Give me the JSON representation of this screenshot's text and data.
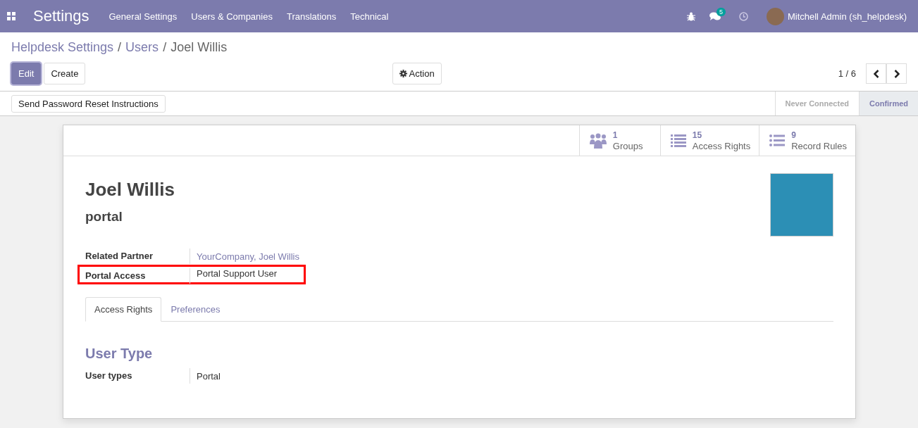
{
  "navbar": {
    "app_title": "Settings",
    "menu": [
      "General Settings",
      "Users & Companies",
      "Translations",
      "Technical"
    ],
    "messages_badge": "5",
    "user": "Mitchell Admin (sh_helpdesk)"
  },
  "breadcrumbs": [
    {
      "label": "Helpdesk Settings",
      "kind": "link"
    },
    {
      "label": "Users",
      "kind": "link",
      "separator": "/"
    },
    {
      "label": "Joel Willis",
      "kind": "current",
      "separator": "/"
    }
  ],
  "buttons": [
    {
      "label": "Edit",
      "kind": "primary"
    },
    {
      "label": "Create",
      "kind": "default"
    }
  ],
  "action_button": "Action",
  "pager": "1 / 6",
  "header_button": "Send Password Reset Instructions",
  "statusbar": [
    {
      "label": "Never Connected",
      "selected": false
    },
    {
      "label": "Confirmed",
      "selected": true
    }
  ],
  "smart_buttons": [
    {
      "count": "1",
      "label": "Groups",
      "kind": "groups"
    },
    {
      "count": "15",
      "label": "Access Rights",
      "kind": "list"
    },
    {
      "count": "9",
      "label": "Record Rules",
      "kind": "rules"
    }
  ],
  "name": "Joel Willis",
  "login": "portal",
  "fields": [
    {
      "label": "Related Partner",
      "value": "YourCompany, Joel Willis",
      "kind": "link",
      "highlighted": false
    },
    {
      "label": "Portal Access",
      "value": "Portal Support User",
      "kind": "text",
      "highlighted": true
    }
  ],
  "tabs": [
    {
      "label": "Access Rights",
      "selected": true
    },
    {
      "label": "Preferences",
      "selected": false
    }
  ],
  "section_title": "User Type",
  "section_fields": [
    {
      "label": "User types",
      "value": "Portal"
    }
  ]
}
